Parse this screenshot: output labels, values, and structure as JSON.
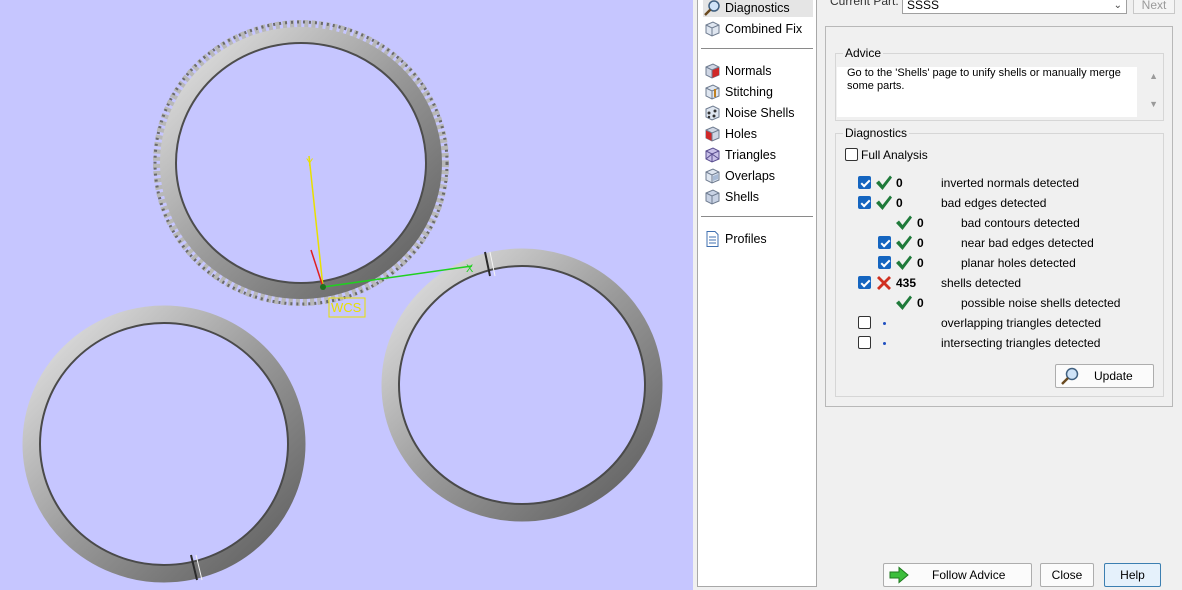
{
  "viewport": {
    "wcs_label": "WCS",
    "axis_y_label": "Y",
    "axis_x_label": "X"
  },
  "nav": {
    "items": [
      {
        "label": "Diagnostics",
        "icon": "magnifier-icon"
      },
      {
        "label": "Combined Fix",
        "icon": "cube-icon"
      },
      {
        "label": "Normals",
        "icon": "normals-cube-icon"
      },
      {
        "label": "Stitching",
        "icon": "stitching-cube-icon"
      },
      {
        "label": "Noise Shells",
        "icon": "noise-shells-cube-icon"
      },
      {
        "label": "Holes",
        "icon": "holes-cube-icon"
      },
      {
        "label": "Triangles",
        "icon": "triangles-cube-icon"
      },
      {
        "label": "Overlaps",
        "icon": "overlaps-cube-icon"
      },
      {
        "label": "Shells",
        "icon": "shells-cube-icon"
      },
      {
        "label": "Profiles",
        "icon": "document-icon"
      }
    ]
  },
  "part": {
    "label": "Current Part:",
    "value": "SSSS",
    "next_label": "Next"
  },
  "advice": {
    "title": "Advice",
    "text": "Go to the 'Shells' page to unify shells or manually merge some parts."
  },
  "diagnostics": {
    "title": "Diagnostics",
    "full_analysis_label": "Full Analysis",
    "full_analysis_checked": false,
    "rows": [
      {
        "checkbox": true,
        "checked": true,
        "status": "ok",
        "count": "0",
        "label": "inverted normals detected",
        "indent": 0
      },
      {
        "checkbox": true,
        "checked": true,
        "status": "ok",
        "count": "0",
        "label": "bad edges detected",
        "indent": 0
      },
      {
        "checkbox": false,
        "checked": false,
        "status": "ok",
        "count": "0",
        "label": "bad contours detected",
        "indent": 1
      },
      {
        "checkbox": true,
        "checked": true,
        "status": "ok",
        "count": "0",
        "label": "near bad edges detected",
        "indent": 1
      },
      {
        "checkbox": true,
        "checked": true,
        "status": "ok",
        "count": "0",
        "label": "planar holes detected",
        "indent": 1
      },
      {
        "checkbox": true,
        "checked": true,
        "status": "error",
        "count": "435",
        "label": "shells detected",
        "indent": 0
      },
      {
        "checkbox": false,
        "checked": false,
        "status": "ok",
        "count": "0",
        "label": "possible noise shells detected",
        "indent": 1
      },
      {
        "checkbox": true,
        "checked": false,
        "status": "pending",
        "count": "",
        "label": "overlapping triangles detected",
        "indent": 0
      },
      {
        "checkbox": true,
        "checked": false,
        "status": "pending",
        "count": "",
        "label": "intersecting triangles detected",
        "indent": 0
      }
    ],
    "update_label": "Update"
  },
  "buttons": {
    "follow_advice": "Follow Advice",
    "close": "Close",
    "help": "Help"
  },
  "colors": {
    "viewport_bg": "#c6c6ff",
    "ok_check": "#1f7a3a",
    "error_x": "#d03020",
    "axis_y": "#e8e000",
    "axis_x": "#20d020",
    "axis_z": "#e02020",
    "ring": "#8c8c8c"
  }
}
